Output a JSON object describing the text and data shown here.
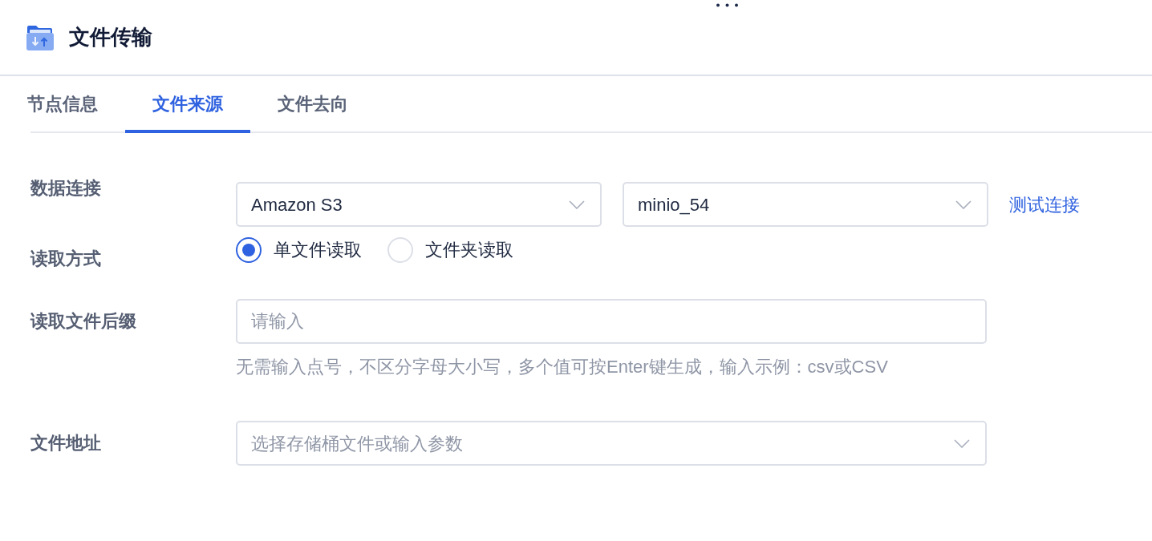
{
  "header": {
    "title": "文件传输"
  },
  "tabs": [
    {
      "label": "节点信息",
      "selected": false
    },
    {
      "label": "文件来源",
      "selected": true
    },
    {
      "label": "文件去向",
      "selected": false
    }
  ],
  "form": [
    {
      "kind": "selects",
      "label": "数据连接",
      "values": [
        "Amazon S3",
        "minio_54"
      ],
      "link": "测试连接"
    },
    {
      "kind": "radio",
      "label": "读取方式",
      "options": [
        {
          "label": "单文件读取",
          "selected": true
        },
        {
          "label": "文件夹读取",
          "selected": false
        }
      ]
    },
    {
      "kind": "input",
      "label": "读取文件后缀",
      "placeholder": "请输入",
      "hint": "无需输入点号，不区分字母大小写，多个值可按Enter键生成，输入示例：csv或CSV"
    },
    {
      "kind": "select",
      "label": "文件地址",
      "placeholder": "选择存储桶文件或输入参数"
    }
  ]
}
